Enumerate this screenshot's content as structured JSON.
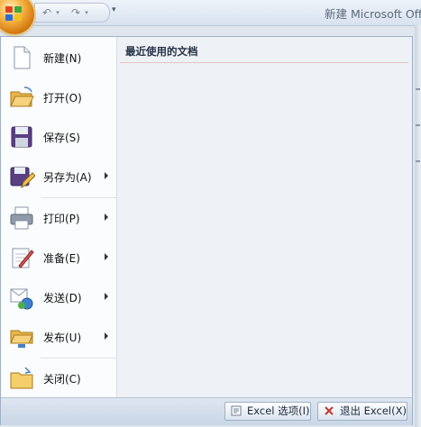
{
  "window": {
    "title": "新建 Microsoft Off"
  },
  "qat": {
    "undo_icon": "undo-icon",
    "redo_icon": "redo-icon",
    "customize_icon": "customize-icon"
  },
  "menu": {
    "items": [
      {
        "label": "新建(N)",
        "icon": "new-document-icon",
        "submenu": false
      },
      {
        "label": "打开(O)",
        "icon": "open-folder-icon",
        "submenu": false
      },
      {
        "label": "保存(S)",
        "icon": "save-disk-icon",
        "submenu": false
      },
      {
        "label": "另存为(A)",
        "icon": "save-as-icon",
        "submenu": true
      },
      {
        "label": "打印(P)",
        "icon": "printer-icon",
        "submenu": true
      },
      {
        "label": "准备(E)",
        "icon": "prepare-icon",
        "submenu": true
      },
      {
        "label": "发送(D)",
        "icon": "send-icon",
        "submenu": true
      },
      {
        "label": "发布(U)",
        "icon": "publish-icon",
        "submenu": true
      },
      {
        "label": "关闭(C)",
        "icon": "close-folder-icon",
        "submenu": false
      }
    ],
    "recent_header": "最近使用的文档",
    "options_button": "Excel 选项(I)",
    "exit_button": "退出 Excel(X)"
  },
  "colors": {
    "office_button": "#f6b545",
    "menu_left_bg": "#fbfcfd",
    "menu_right_bg": "#eef1f5",
    "header_rule": "#e5c7be"
  }
}
